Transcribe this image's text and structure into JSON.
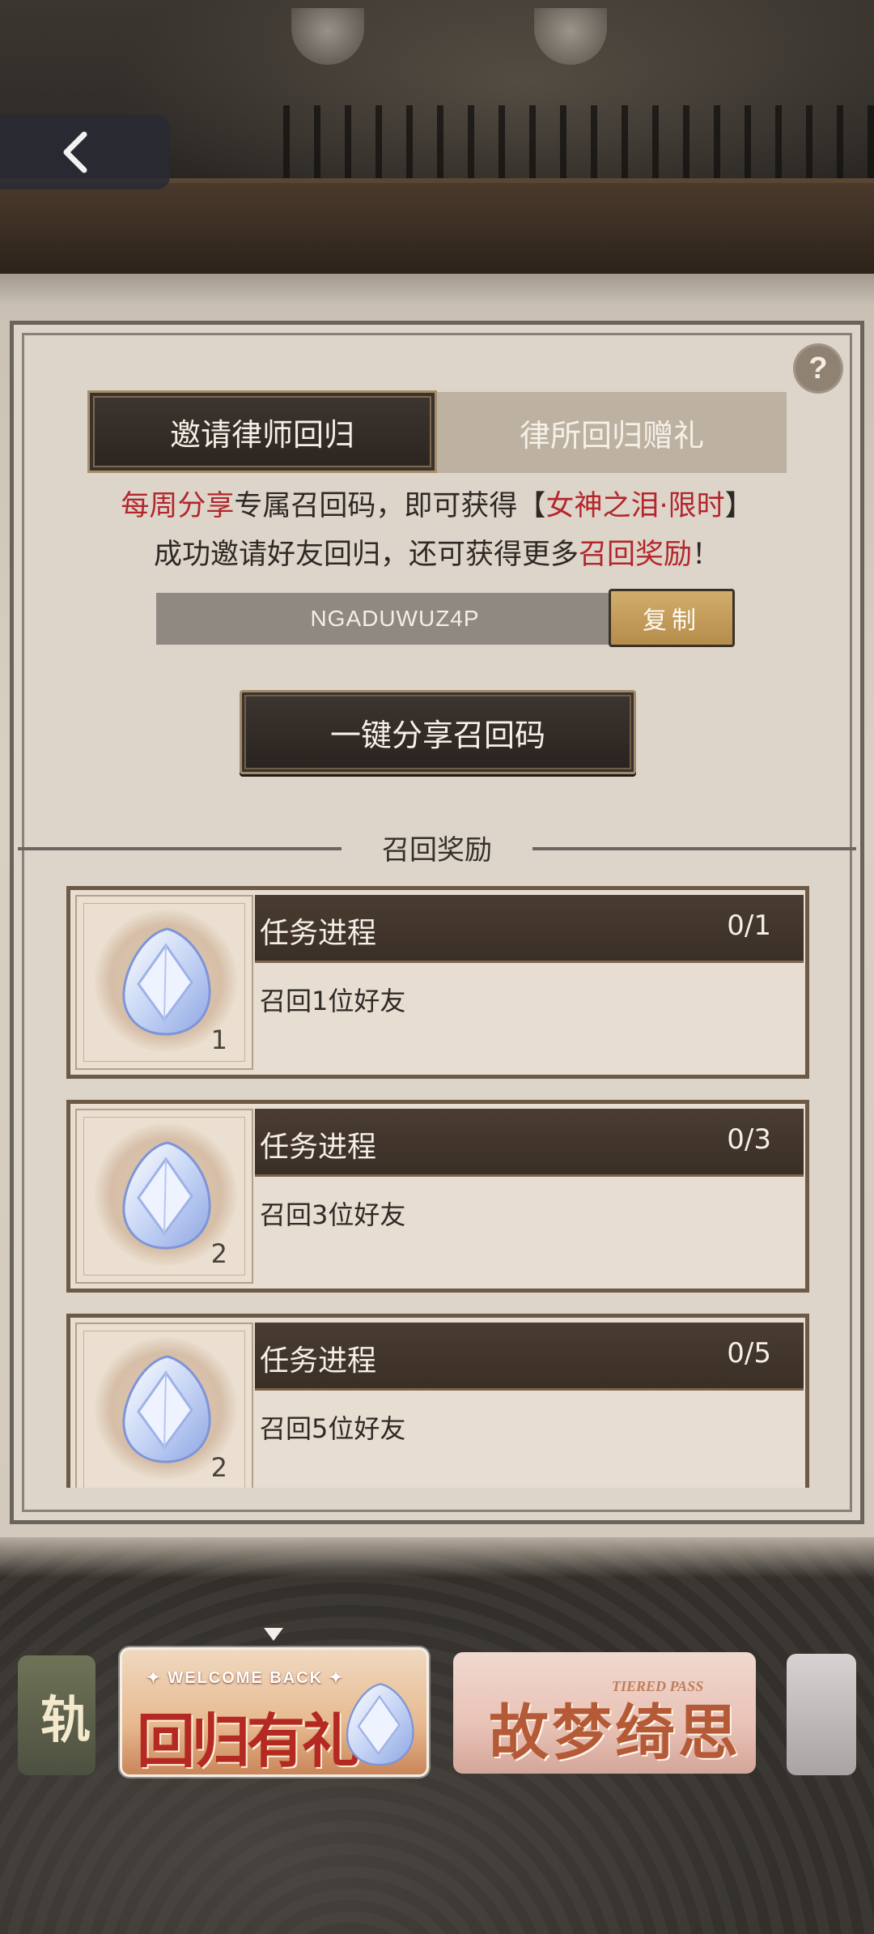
{
  "header": {
    "back_icon": "chevron-left-icon"
  },
  "help": {
    "label": "?"
  },
  "tabs": [
    {
      "label": "邀请律师回归",
      "active": true
    },
    {
      "label": "律所回归赠礼",
      "active": false
    }
  ],
  "description": {
    "line1": [
      {
        "text": "每周分享",
        "highlight": true
      },
      {
        "text": "专属召回码，即可获得【",
        "highlight": false
      },
      {
        "text": "女神之泪·限时",
        "highlight": true
      },
      {
        "text": "】",
        "highlight": false
      }
    ],
    "line2": [
      {
        "text": "成功邀请好友回归，还可获得更多",
        "highlight": false
      },
      {
        "text": "召回奖励",
        "highlight": true
      },
      {
        "text": "！",
        "highlight": false
      }
    ]
  },
  "invite": {
    "code": "NGADUWUZ4P",
    "copy_label": "复制",
    "share_label": "一键分享召回码"
  },
  "rewards": {
    "section_title": "召回奖励",
    "items": [
      {
        "title": "任务进程",
        "progress": "0/1",
        "description": "召回1位好友",
        "reward_count": "1",
        "reward_icon": "goddess-tear-crystal-icon"
      },
      {
        "title": "任务进程",
        "progress": "0/3",
        "description": "召回3位好友",
        "reward_count": "2",
        "reward_icon": "goddess-tear-crystal-icon"
      },
      {
        "title": "任务进程",
        "progress": "0/5",
        "description": "召回5位好友",
        "reward_count": "2",
        "reward_icon": "goddess-tear-crystal-icon"
      }
    ]
  },
  "carousel": {
    "left_partial": "轨",
    "main": {
      "top_text": "✦ WELCOME BACK ✦",
      "title": "回归有礼"
    },
    "mid": {
      "tag": "TIERED PASS",
      "title": "故梦绮思"
    }
  },
  "colors": {
    "highlight_red": "#b3262c",
    "copy_gold": "#c49d5b",
    "dark_button": "#2f2824"
  }
}
